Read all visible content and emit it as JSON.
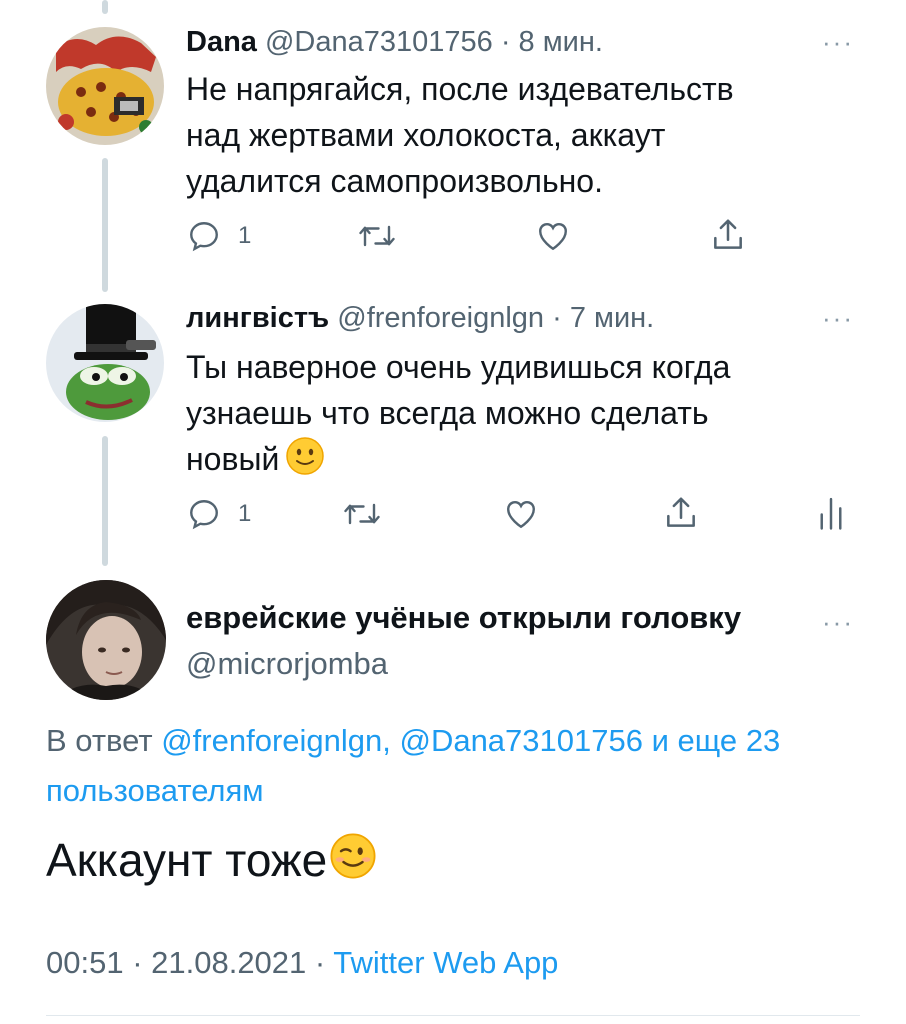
{
  "tweets": [
    {
      "name": "Dana",
      "handle": "@Dana73101756",
      "time": "· 8 мин.",
      "more": "···",
      "text_lines": [
        "Не напрягайся, после издевательств",
        "над жертвами холокоста, аккаут",
        "удалится самопроизвольно."
      ],
      "reply_count": "1",
      "icons": [
        "reply-icon",
        "retweet-icon",
        "like-icon",
        "share-icon"
      ]
    },
    {
      "name": "лингвiстъ",
      "handle": "@frenforeignlgn",
      "time": "· 7 мин.",
      "more": "···",
      "text_lines": [
        "Ты наверное очень удивишься когда",
        "узнаешь что всегда можно сделать",
        "новый"
      ],
      "emoji": "slightly-smiling-face",
      "reply_count": "1",
      "icons": [
        "reply-icon",
        "retweet-icon",
        "like-icon",
        "share-icon",
        "analytics-icon"
      ]
    }
  ],
  "main_tweet": {
    "name": "еврейские учёные открыли головку",
    "handle": "@microrjomba",
    "more": "···",
    "reply_prefix": "В ответ",
    "reply_mentions": "@frenforeignlgn, @Dana73101756",
    "reply_and": "и еще",
    "reply_others": "23 пользователям",
    "text": "Аккаунт тоже",
    "emoji": "winking-face",
    "time": "00:51 · 21.08.2021 ·",
    "source": "Twitter Web App"
  },
  "colors": {
    "link": "#1d9bf0",
    "muted": "#536471",
    "thread_line": "#cfd9de"
  }
}
